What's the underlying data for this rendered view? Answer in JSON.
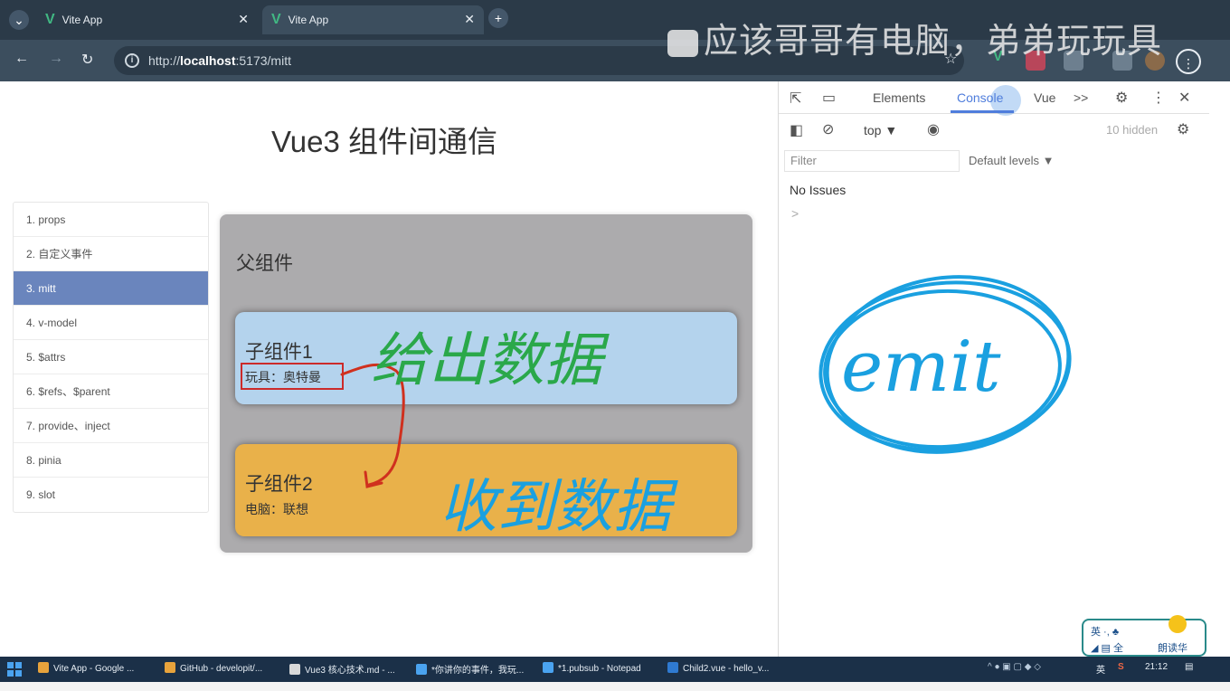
{
  "browser": {
    "tabs": [
      {
        "label": "Vite App"
      },
      {
        "label": "Vite App"
      }
    ],
    "url_prefix": "http://",
    "url_host": "localhost",
    "url_rest": ":5173/mitt"
  },
  "watermark": "应该哥哥有电脑，弟弟玩玩具",
  "page": {
    "title": "Vue3 组件间通信",
    "nav": [
      "1. props",
      "2. 自定义事件",
      "3. mitt",
      "4. v-model",
      "5. $attrs",
      "6. $refs、$parent",
      "7. provide、inject",
      "8. pinia",
      "9. slot"
    ],
    "active_nav": "3. mitt",
    "parent": {
      "title": "父组件",
      "child1": {
        "title": "子组件1",
        "prop": "玩具：奥特曼"
      },
      "child2": {
        "title": "子组件2",
        "prop": "电脑：联想"
      }
    }
  },
  "devtools": {
    "tabs": {
      "elements": "Elements",
      "console": "Console",
      "vue": "Vue",
      "more": ">>"
    },
    "context": "top ▼",
    "hidden": "10 hidden",
    "filter_placeholder": "Filter",
    "levels": "Default levels ▼",
    "issues": "No Issues",
    "prompt": ">"
  },
  "annotations": {
    "send_data": "给出数据",
    "receive_data": "收到数据",
    "emit": "emit"
  },
  "ime": {
    "row1": "英 ·, ♣",
    "row2": "◢ ▤ 全",
    "brand": "朗读华"
  },
  "taskbar": {
    "items": [
      "Vite App - Google ...",
      "GitHub - developit/...",
      "Vue3 核心技术.md - ...",
      "*你讲你的事件，我玩...",
      "*1.pubsub - Notepad",
      "Child2.vue - hello_v..."
    ],
    "clock": "21:12",
    "tray_lang": "英"
  },
  "colors": {
    "nav_active": "#6a85bd",
    "child1_bg": "#b4d3ed",
    "child2_bg": "#e9b14a",
    "parent_bg": "#acabad",
    "ink_green": "#2aa84a",
    "ink_blue": "#1aa0e0",
    "ink_red": "#d0301e"
  }
}
